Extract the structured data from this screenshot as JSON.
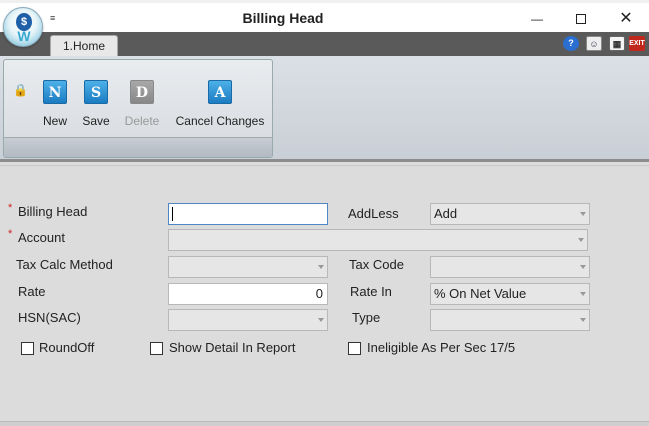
{
  "window": {
    "title": "Billing Head",
    "qat_arrow": "≡"
  },
  "window_controls": {
    "minimize": "—",
    "close": "✕"
  },
  "tabs": [
    {
      "label": "1.Home"
    }
  ],
  "top_icons": {
    "help": "?",
    "user": "☺",
    "calc": "▦",
    "exit": "EXIT"
  },
  "ribbon": {
    "lock": "🔒",
    "buttons": [
      {
        "icon_letter": "N",
        "label": "New",
        "enabled": true
      },
      {
        "icon_letter": "S",
        "label": "Save",
        "enabled": true
      },
      {
        "icon_letter": "D",
        "label": "Delete",
        "enabled": false
      },
      {
        "icon_letter": "A",
        "label": "Cancel Changes",
        "enabled": true
      }
    ]
  },
  "form": {
    "billing_head": {
      "label": "Billing Head",
      "required_mark": "*",
      "value": ""
    },
    "addless": {
      "label": "AddLess",
      "value": "Add"
    },
    "account": {
      "label": "Account",
      "required_mark": "*",
      "value": ""
    },
    "tax_calc_method": {
      "label": "Tax Calc Method",
      "value": ""
    },
    "tax_code": {
      "label": "Tax Code",
      "value": ""
    },
    "rate": {
      "label": "Rate",
      "value": "0"
    },
    "rate_in": {
      "label": "Rate In",
      "value": "% On Net Value"
    },
    "hsn_sac": {
      "label": "HSN(SAC)",
      "value": ""
    },
    "type": {
      "label": "Type",
      "value": ""
    },
    "checkboxes": [
      {
        "label": "RoundOff",
        "checked": false
      },
      {
        "label": "Show Detail In Report",
        "checked": false
      },
      {
        "label": "Ineligible As Per Sec 17/5",
        "checked": false
      }
    ]
  },
  "colors": {
    "accent": "#1b7cc2",
    "required": "#d02020",
    "tabbar": "#5a5a5a",
    "focus_border": "#4f86c6"
  }
}
